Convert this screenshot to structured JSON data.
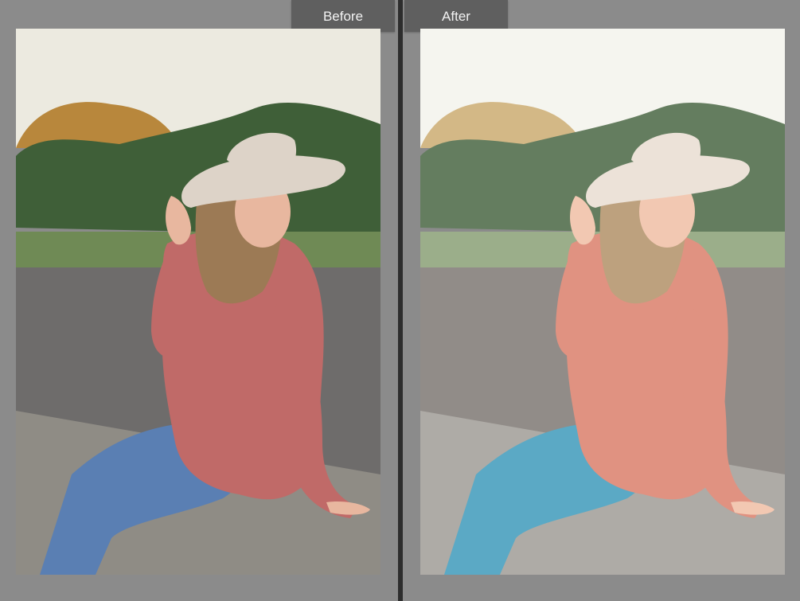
{
  "compare_view": {
    "before_label": "Before",
    "after_label": "After"
  },
  "before_photo": {
    "sky": "#eceae0",
    "trees": "#3f5f38",
    "tree_highlight": "#b8873c",
    "grass": "#6f8a55",
    "road": "#6e6c6b",
    "sweater": "#c06a68",
    "jeans": "#5a7fb3",
    "hat": "#ddd3c8",
    "hair": "#9c7a55",
    "skin": "#e8b79f",
    "stone": "#8f8c85"
  },
  "after_photo": {
    "sky": "#f5f2ea",
    "trees": "#5b7656",
    "tree_highlight": "#cfb27c",
    "grass": "#94a882",
    "road": "#8a8581",
    "sweater": "#df8a78",
    "jeans": "#4fa4c2",
    "hat": "#e8ddd2",
    "hair": "#b99a75",
    "skin": "#f0c2aa",
    "stone": "#a8a59f"
  }
}
